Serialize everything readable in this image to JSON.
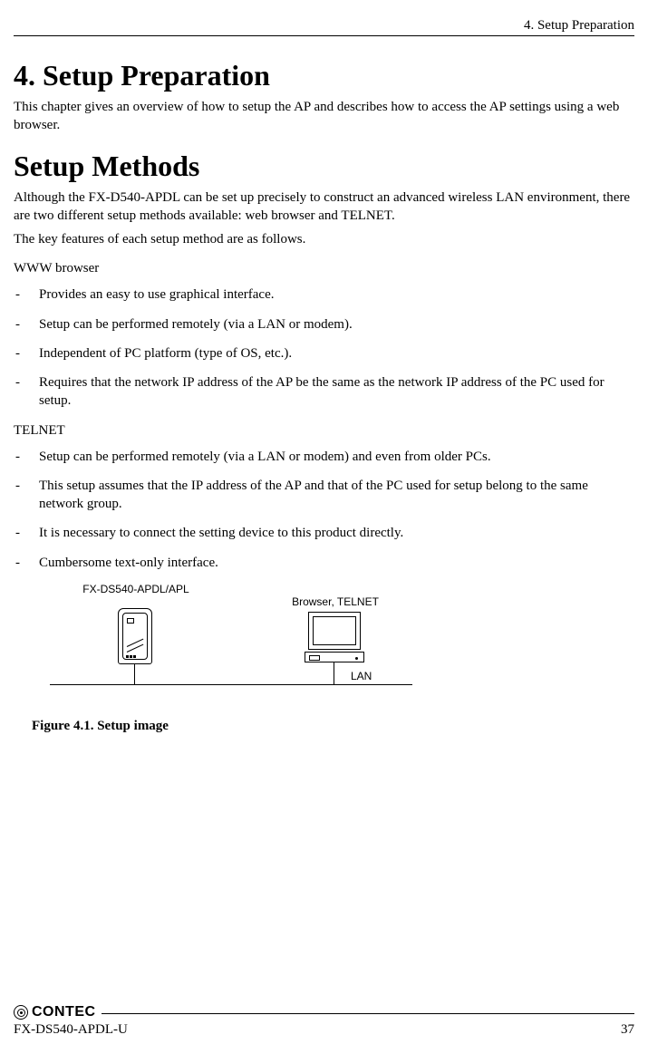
{
  "header": {
    "section_label": "4. Setup Preparation"
  },
  "chapter": {
    "title": "4.  Setup Preparation",
    "intro": "This chapter gives an overview of how to setup the AP and describes how to access the AP settings using a web browser."
  },
  "section": {
    "title": "Setup Methods",
    "para1": "Although the FX-D540-APDL can be set up precisely to construct an advanced wireless LAN environment, there are two different setup methods available: web browser and TELNET.",
    "para2": "The key features of each setup method are as follows."
  },
  "www": {
    "heading": "WWW browser",
    "items": [
      "Provides an easy to use graphical interface.",
      "Setup can be performed remotely (via a LAN or modem).",
      "Independent of PC platform (type of OS, etc.).",
      "Requires that the network IP address of the AP be the same as the network IP address of the PC used for setup."
    ]
  },
  "telnet": {
    "heading": "TELNET",
    "items": [
      "Setup can be performed remotely (via a LAN or modem) and even from older PCs.",
      "This setup assumes that the IP address of the AP and that of the PC used for setup belong to the same network group.",
      "It is necessary to connect the setting device to this product directly.",
      "Cumbersome text-only interface."
    ]
  },
  "figure": {
    "ap_label": "FX-DS540-APDL/APL",
    "pc_label": "Browser, TELNET",
    "lan_label": "LAN",
    "caption": "Figure 4.1.  Setup image"
  },
  "footer": {
    "brand": "CONTEC",
    "model": "FX-DS540-APDL-U",
    "page": "37"
  }
}
